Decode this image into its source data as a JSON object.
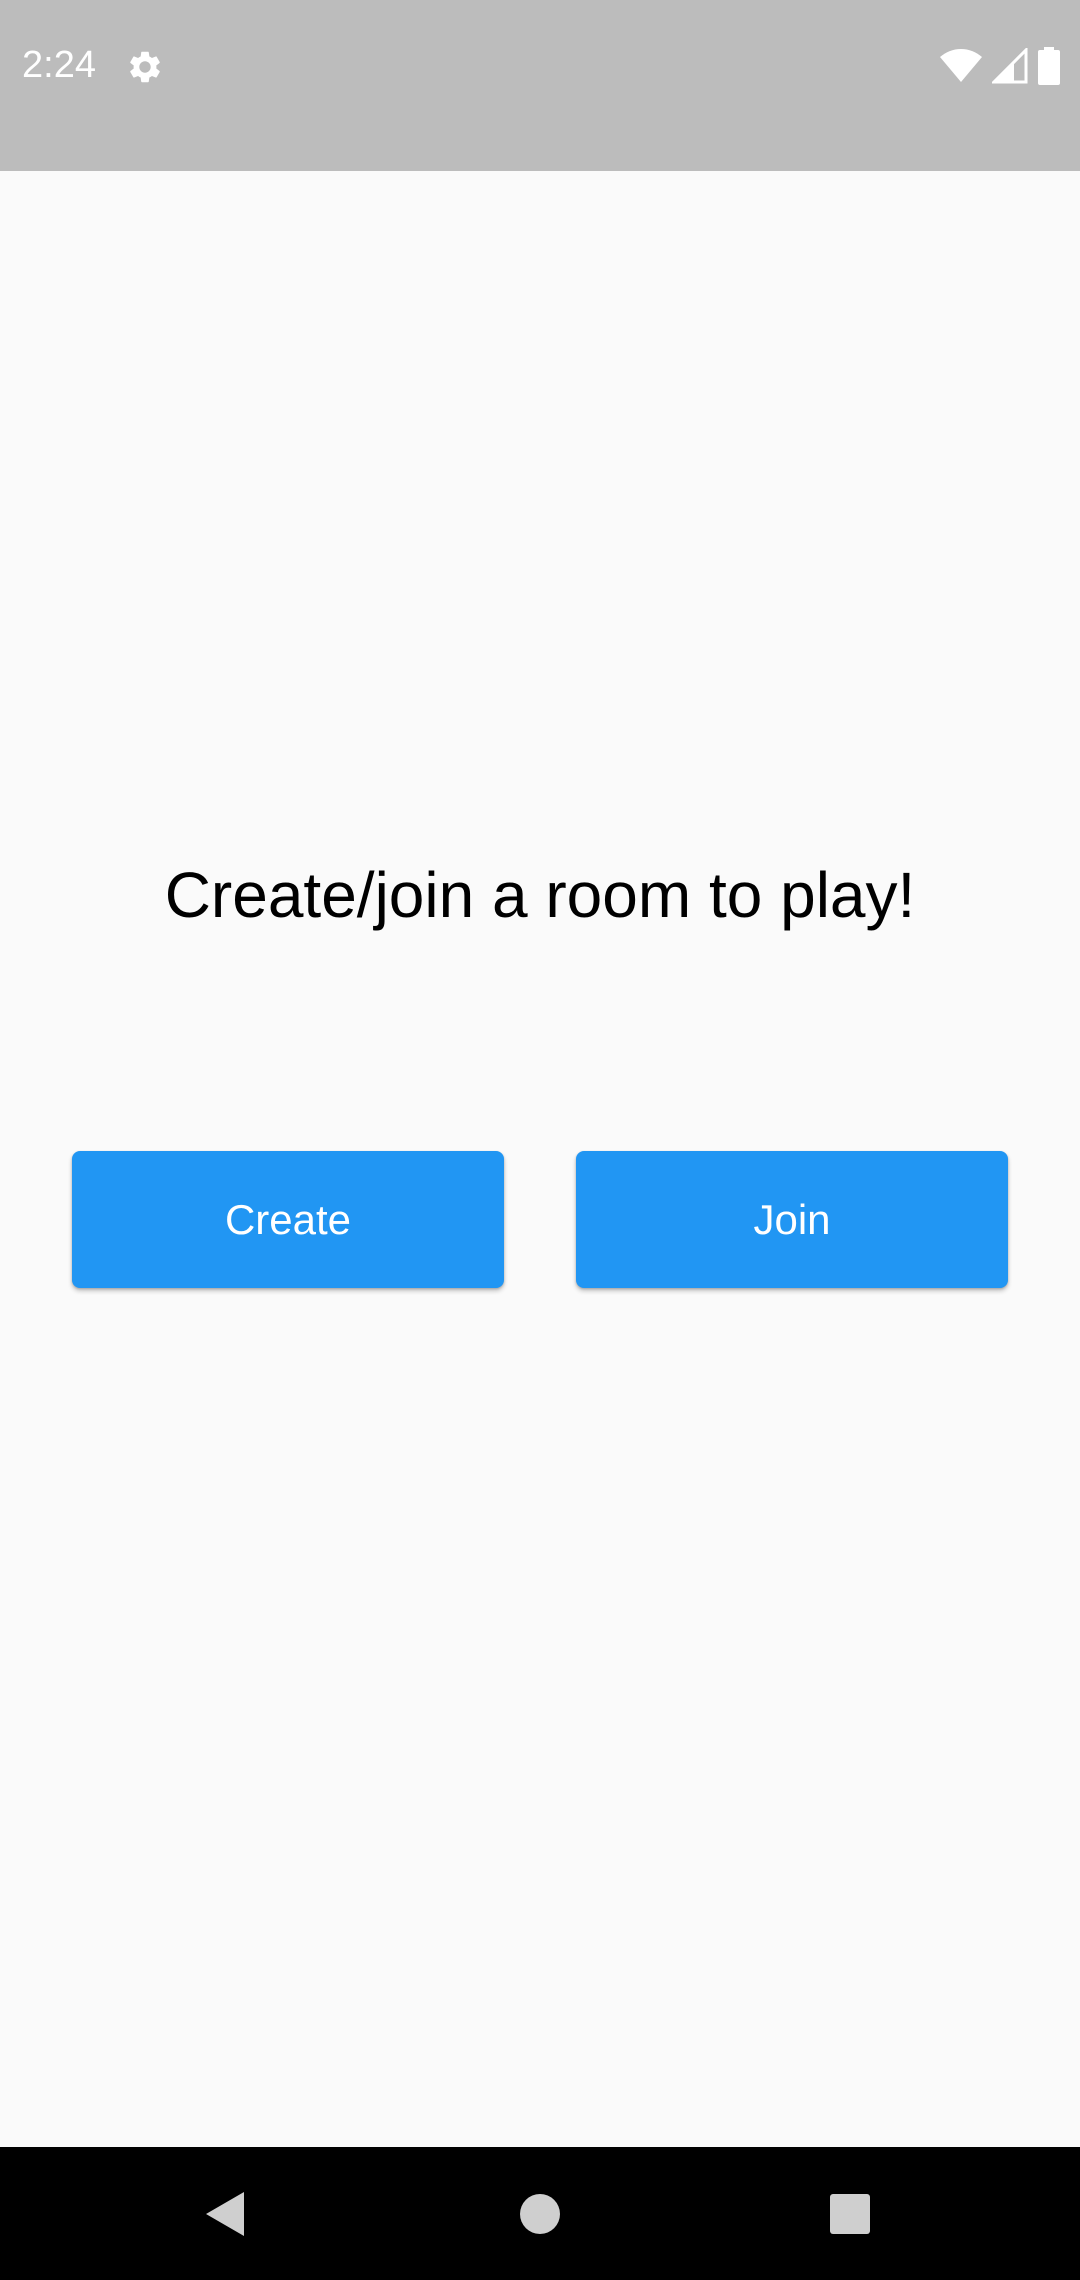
{
  "status_bar": {
    "time": "2:24",
    "background": "#bcbcbc",
    "icons": [
      "settings-icon",
      "wifi-icon",
      "cell-signal-icon",
      "battery-icon"
    ]
  },
  "main": {
    "headline": "Create/join a room to play!",
    "create_label": "Create",
    "join_label": "Join",
    "button_color": "#2196f3",
    "background": "#fafafa"
  },
  "nav_bar": {
    "buttons": [
      "back-icon",
      "home-icon",
      "recents-icon"
    ],
    "background": "#000000"
  }
}
